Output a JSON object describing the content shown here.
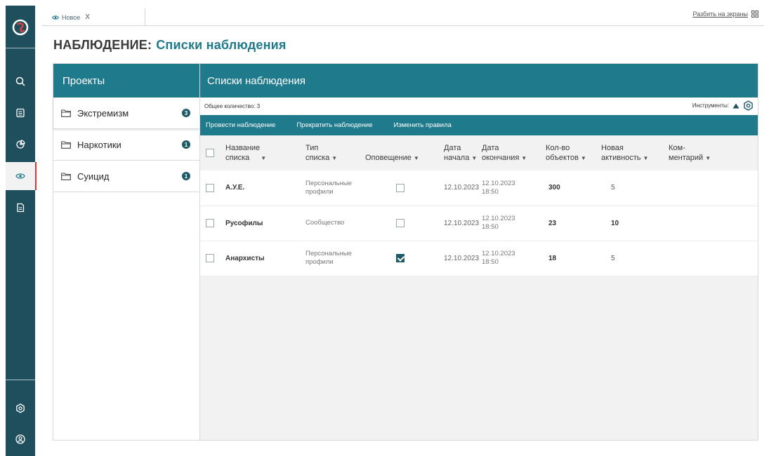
{
  "rail": {
    "top_icons": [
      "search-icon",
      "document-list-icon",
      "chart-icon",
      "eye-icon",
      "report-icon"
    ],
    "bottom_icons": [
      "settings-icon",
      "user-icon"
    ],
    "active": "eye-icon",
    "accent": "#1f4f5c"
  },
  "tabbar": {
    "tab_label": "Новое",
    "close": "X",
    "split_label": "Разбить на экраны"
  },
  "page": {
    "title": "НАБЛЮДЕНИЕ:",
    "subtitle": "Списки наблюдения"
  },
  "projects": {
    "header": "Проекты",
    "items": [
      {
        "label": "Экстремизм",
        "count": "3"
      },
      {
        "label": "Наркотики",
        "count": "1"
      },
      {
        "label": "Суицид",
        "count": "1"
      }
    ]
  },
  "lists": {
    "header": "Списки наблюдения",
    "total": "Общее количество: 3",
    "tools": "Инструменты:",
    "actions": [
      "Провести наблюдение",
      "Прекратить наблюдение",
      "Изменить правила"
    ],
    "columns": {
      "name": [
        "Название",
        "списка"
      ],
      "type": [
        "Тип",
        "списка"
      ],
      "notify": "Оповещение",
      "start": [
        "Дата",
        "начала"
      ],
      "end": [
        "Дата",
        "окончания"
      ],
      "objects": [
        "Кол-во",
        "объектов"
      ],
      "activity": [
        "Новая",
        "активность"
      ],
      "comment": [
        "Ком-",
        "ментарий"
      ]
    },
    "rows": [
      {
        "name": "А.У.Е.",
        "type": "Персональные профили",
        "notify": false,
        "start": "12.10.2023",
        "end_date": "12.10.2023",
        "end_time": "18:50",
        "objects": "300",
        "activity": "5"
      },
      {
        "name": "Русофилы",
        "type": "Сообщество",
        "notify": false,
        "start": "12.10.2023",
        "end_date": "12.10.2023",
        "end_time": "18:50",
        "objects": "23",
        "activity": "10"
      },
      {
        "name": "Анархисты",
        "type": "Персональные профили",
        "notify": true,
        "start": "12.10.2023",
        "end_date": "12.10.2023",
        "end_time": "18:50",
        "objects": "18",
        "activity": "5"
      }
    ]
  },
  "colors": {
    "primary": "#1f7a8c",
    "dark": "#1f4f5c",
    "badge": "#1f5a67"
  }
}
